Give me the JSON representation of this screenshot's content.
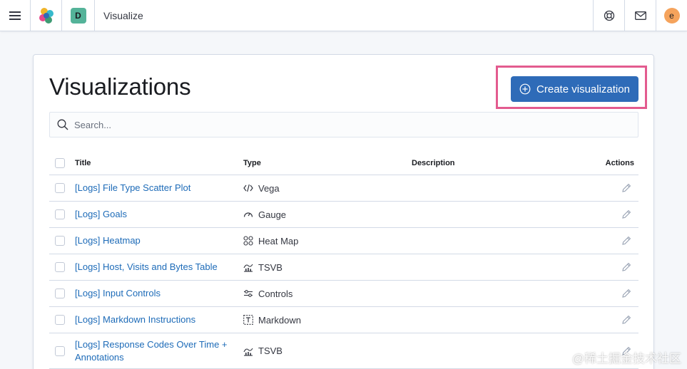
{
  "header": {
    "breadcrumb": "Visualize",
    "space_initial": "D",
    "user_initial": "e"
  },
  "page": {
    "title": "Visualizations",
    "create_button_label": "Create visualization",
    "search_placeholder": "Search..."
  },
  "table": {
    "columns": {
      "title": "Title",
      "type": "Type",
      "description": "Description",
      "actions": "Actions"
    },
    "rows": [
      {
        "title": "[Logs] File Type Scatter Plot",
        "type": "Vega",
        "type_icon": "code-icon"
      },
      {
        "title": "[Logs] Goals",
        "type": "Gauge",
        "type_icon": "gauge-icon"
      },
      {
        "title": "[Logs] Heatmap",
        "type": "Heat Map",
        "type_icon": "heatmap-icon"
      },
      {
        "title": "[Logs] Host, Visits and Bytes Table",
        "type": "TSVB",
        "type_icon": "tsvb-icon"
      },
      {
        "title": "[Logs] Input Controls",
        "type": "Controls",
        "type_icon": "controls-icon"
      },
      {
        "title": "[Logs] Markdown Instructions",
        "type": "Markdown",
        "type_icon": "markdown-icon"
      },
      {
        "title_line1": "[Logs] Response Codes Over Time +",
        "title_line2": "Annotations",
        "type": "TSVB",
        "type_icon": "tsvb-icon"
      }
    ]
  },
  "watermark": "@稀土掘金技术社区",
  "colors": {
    "primary": "#2e6bb8",
    "link": "#1d6bb8",
    "highlight": "#e35b8f",
    "space_badge": "#54b399",
    "avatar": "#f5a35c"
  }
}
